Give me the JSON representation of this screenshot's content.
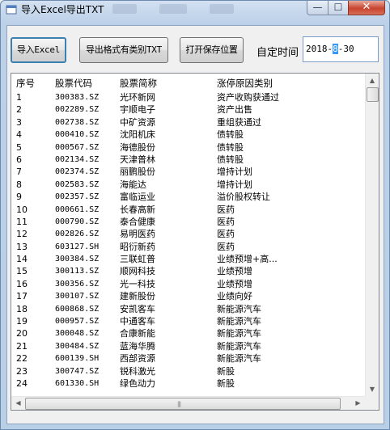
{
  "window": {
    "title": "导入Excel导出TXT"
  },
  "title_buttons": {
    "minimize_glyph": "—",
    "maximize_glyph": "☐",
    "close_glyph": "✕"
  },
  "toolbar": {
    "import_label": "导入Excel",
    "export_label": "导出格式有类别TXT",
    "open_label": "打开保存位置",
    "time_label": "自定时间"
  },
  "date": {
    "year": "2018-",
    "month_selected": "8",
    "rest": "-30"
  },
  "grid": {
    "columns": [
      "序号",
      "股票代码",
      "股票简称",
      "涨停原因类别"
    ],
    "rows": [
      [
        "1",
        "300383.SZ",
        "光环新网",
        "资产收购获通过"
      ],
      [
        "2",
        "002289.SZ",
        "宇顺电子",
        "资产出售"
      ],
      [
        "3",
        "002738.SZ",
        "中矿资源",
        "重组获通过"
      ],
      [
        "4",
        "000410.SZ",
        "沈阳机床",
        "债转股"
      ],
      [
        "5",
        "000567.SZ",
        "海德股份",
        "债转股"
      ],
      [
        "6",
        "002134.SZ",
        "天津普林",
        "债转股"
      ],
      [
        "7",
        "002374.SZ",
        "丽鹏股份",
        "增持计划"
      ],
      [
        "8",
        "002583.SZ",
        "海能达",
        "增持计划"
      ],
      [
        "9",
        "002357.SZ",
        "富临运业",
        "溢价股权转让"
      ],
      [
        "10",
        "000661.SZ",
        "长春高新",
        "医药"
      ],
      [
        "11",
        "000790.SZ",
        "泰合健康",
        "医药"
      ],
      [
        "12",
        "002826.SZ",
        "易明医药",
        "医药"
      ],
      [
        "13",
        "603127.SH",
        "昭衍新药",
        "医药"
      ],
      [
        "14",
        "300384.SZ",
        "三联虹普",
        "业绩预增+高..."
      ],
      [
        "15",
        "300113.SZ",
        "顺网科技",
        "业绩预增"
      ],
      [
        "16",
        "300356.SZ",
        "光一科技",
        "业绩预增"
      ],
      [
        "17",
        "300107.SZ",
        "建新股份",
        "业绩向好"
      ],
      [
        "18",
        "600868.SZ",
        "安凯客车",
        "新能源汽车"
      ],
      [
        "19",
        "000957.SZ",
        "中通客车",
        "新能源汽车"
      ],
      [
        "20",
        "300048.SZ",
        "合康新能",
        "新能源汽车"
      ],
      [
        "21",
        "300484.SZ",
        "蓝海华腾",
        "新能源汽车"
      ],
      [
        "22",
        "600139.SH",
        "西部资源",
        "新能源汽车"
      ],
      [
        "23",
        "300747.SZ",
        "锐科激光",
        "新股"
      ],
      [
        "24",
        "601330.SH",
        "绿色动力",
        "新股"
      ]
    ]
  },
  "scroll": {
    "up_glyph": "▲",
    "down_glyph": "▼",
    "left_glyph": "◀",
    "right_glyph": "▶",
    "grip": "|||"
  }
}
